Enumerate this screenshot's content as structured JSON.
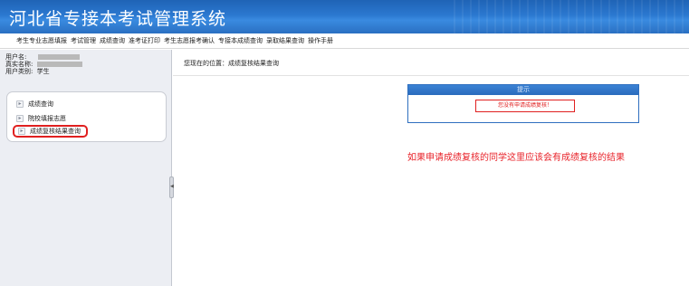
{
  "header": {
    "title": "河北省专接本考试管理系统"
  },
  "nav": {
    "items": [
      "考生专业志愿填报",
      "考试管理",
      "成绩查询",
      "准考证打印",
      "考生志愿报考确认",
      "专接本成绩查询",
      "录取结果查询",
      "操作手册"
    ]
  },
  "user": {
    "user_label": "用户名:",
    "name_label": "真实名称:",
    "role_label": "用户类别:",
    "role_value": "学生"
  },
  "sidebar": {
    "items": [
      {
        "label": "成绩查询"
      },
      {
        "label": "院校填报志愿"
      },
      {
        "label": "成绩复核结果查询"
      }
    ],
    "collapse_glyph": "◀"
  },
  "breadcrumb": "您现在的位置：成绩复核结果查询",
  "result": {
    "header": "提示",
    "message": "您没有申请成绩复核！"
  },
  "annotation": "如果申请成绩复核的同学这里应该会有成绩复核的结果",
  "colors": {
    "banner": "#2b78d0",
    "highlight": "#e02020",
    "annotation": "#e8232a"
  }
}
